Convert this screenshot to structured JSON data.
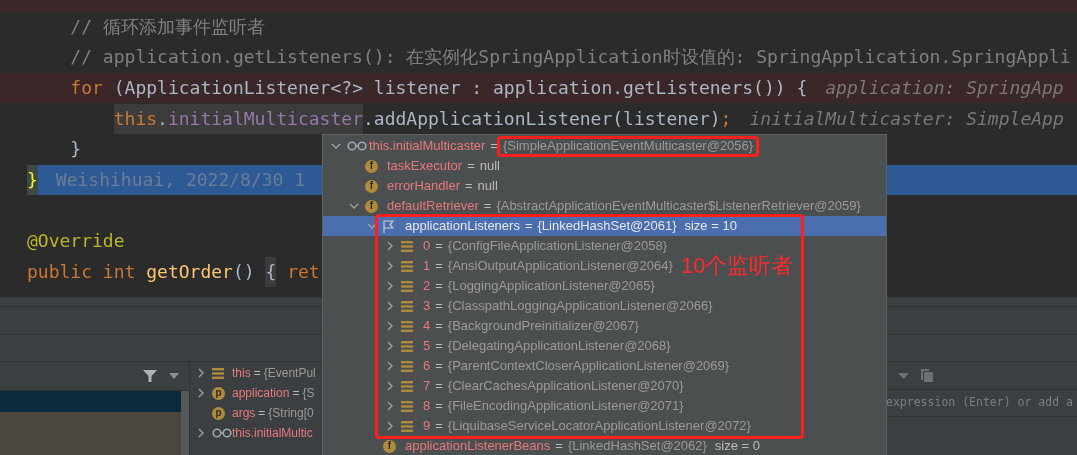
{
  "editor": {
    "lines": [
      {
        "kind": "breakpoint"
      },
      {
        "kind": "normal",
        "tokens": [
          {
            "kind": "comment",
            "t": "    // 循环添加事件监听者",
            "highlighted": false
          }
        ]
      },
      {
        "kind": "normal",
        "tokens": [
          {
            "kind": "comment",
            "t": "    // application.getListeners(): 在实例化SpringApplication时设值的: SpringApplication.SpringAppli",
            "highlighted": false
          }
        ]
      },
      {
        "kind": "breakpoint",
        "tokens": [
          {
            "kind": "keyword",
            "t": "    for",
            "highlighted": false
          },
          {
            "kind": "plain",
            "t": " (ApplicationListener<?> listener : application.getListeners()) {",
            "highlighted": false
          },
          {
            "kind": "hint",
            "t": "application: SpringApp",
            "highlighted": false
          }
        ]
      },
      {
        "kind": "normal",
        "tokens": [
          {
            "kind": "keyword",
            "t": "        this",
            "highlighted": true
          },
          {
            "kind": "plain",
            "t": ".",
            "highlighted": true
          },
          {
            "kind": "field",
            "t": "initialMulticaster",
            "highlighted": true
          },
          {
            "kind": "plain",
            "t": ".addApplicationListener(listener)",
            "highlighted": false
          },
          {
            "kind": "keyword",
            "t": ";",
            "highlighted": false
          },
          {
            "kind": "hint",
            "t": "initialMulticaster: SimpleApp",
            "highlighted": false
          }
        ]
      },
      {
        "kind": "normal",
        "tokens": [
          {
            "kind": "plain",
            "t": "    }",
            "highlighted": false
          }
        ]
      },
      {
        "kind": "current",
        "tokens": [
          {
            "kind": "brace",
            "t": "}",
            "highlighted": true
          },
          {
            "kind": "blame",
            "t": "Weishihuai, 2022/8/30 1",
            "highlighted": false
          }
        ]
      },
      {
        "kind": "normal"
      },
      {
        "kind": "normal",
        "tokens": [
          {
            "kind": "annotation",
            "t": "@Override",
            "highlighted": false
          }
        ]
      },
      {
        "kind": "normal",
        "tokens": [
          {
            "kind": "keyword",
            "t": "public int ",
            "highlighted": false
          },
          {
            "kind": "method",
            "t": "getOrder",
            "highlighted": false
          },
          {
            "kind": "plain",
            "t": "() ",
            "highlighted": false
          },
          {
            "kind": "plain",
            "t": "{",
            "highlighted": true
          },
          {
            "kind": "keyword",
            "t": " ret",
            "highlighted": false
          }
        ]
      }
    ]
  },
  "frames": [
    {
      "selected": true
    },
    {
      "selected": false
    },
    {
      "selected": false
    }
  ],
  "variables": [
    {
      "expanded": false,
      "kind": "object",
      "name": "this",
      "op": "=",
      "value": "{EventPul"
    },
    {
      "expanded": false,
      "kind": "parameter",
      "badge": "p",
      "name": "application",
      "op": "=",
      "value": "{S"
    },
    {
      "kind": "parameter",
      "badge": "p",
      "name": "args",
      "op": "=",
      "value": "{String[0"
    },
    {
      "expanded": false,
      "kind": "watch",
      "name": "this.initialMultic"
    }
  ],
  "evaluate": {
    "placeholder": "expression (Enter) or add a"
  },
  "popup": {
    "tree": {
      "kind": "watch",
      "name": "this.initialMulticaster",
      "op": "=",
      "value": "{SimpleApplicationEventMulticaster@2056}",
      "expanded": true,
      "selected": false,
      "children": [
        {
          "kind": "field",
          "badge": "f",
          "name": "taskExecutor",
          "op": "=",
          "value": "null",
          "selected": false
        },
        {
          "kind": "field",
          "badge": "f",
          "name": "errorHandler",
          "op": "=",
          "value": "null",
          "selected": false
        },
        {
          "kind": "field",
          "badge": "f",
          "name": "defaultRetriever",
          "op": "=",
          "value": "{AbstractApplicationEventMulticaster$ListenerRetriever@2059}",
          "expanded": true,
          "selected": false,
          "children": [
            {
              "kind": "flagged",
              "name": "applicationListeners",
              "op": "=",
              "value": "{LinkedHashSet@2061}",
              "extra": "size = 10",
              "expanded": true,
              "selected": true,
              "children": [
                {
                  "kind": "object",
                  "name": "0",
                  "op": "=",
                  "value": "{ConfigFileApplicationListener@2058}",
                  "expanded": false,
                  "selected": false
                },
                {
                  "kind": "object",
                  "name": "1",
                  "op": "=",
                  "value": "{AnsiOutputApplicationListener@2064}",
                  "expanded": false,
                  "selected": false
                },
                {
                  "kind": "object",
                  "name": "2",
                  "op": "=",
                  "value": "{LoggingApplicationListener@2065}",
                  "expanded": false,
                  "selected": false
                },
                {
                  "kind": "object",
                  "name": "3",
                  "op": "=",
                  "value": "{ClasspathLoggingApplicationListener@2066}",
                  "expanded": false,
                  "selected": false
                },
                {
                  "kind": "object",
                  "name": "4",
                  "op": "=",
                  "value": "{BackgroundPreinitializer@2067}",
                  "expanded": false,
                  "selected": false
                },
                {
                  "kind": "object",
                  "name": "5",
                  "op": "=",
                  "value": "{DelegatingApplicationListener@2068}",
                  "expanded": false,
                  "selected": false
                },
                {
                  "kind": "object",
                  "name": "6",
                  "op": "=",
                  "value": "{ParentContextCloserApplicationListener@2069}",
                  "expanded": false,
                  "selected": false
                },
                {
                  "kind": "object",
                  "name": "7",
                  "op": "=",
                  "value": "{ClearCachesApplicationListener@2070}",
                  "expanded": false,
                  "selected": false
                },
                {
                  "kind": "object",
                  "name": "8",
                  "op": "=",
                  "value": "{FileEncodingApplicationListener@2071}",
                  "expanded": false,
                  "selected": false
                },
                {
                  "kind": "object",
                  "name": "9",
                  "op": "=",
                  "value": "{LiquibaseServiceLocatorApplicationListener@2072}",
                  "expanded": false,
                  "selected": false
                }
              ]
            },
            {
              "kind": "field",
              "badge": "f",
              "name": "applicationListenerBeans",
              "op": "=",
              "value": "{LinkedHashSet@2062}",
              "extra": "size = 0",
              "selected": false
            }
          ]
        }
      ]
    }
  },
  "annotations": [
    {
      "kind": "root-box"
    },
    {
      "kind": "list-box"
    },
    {
      "kind": "label",
      "text": "10个监听者"
    }
  ]
}
